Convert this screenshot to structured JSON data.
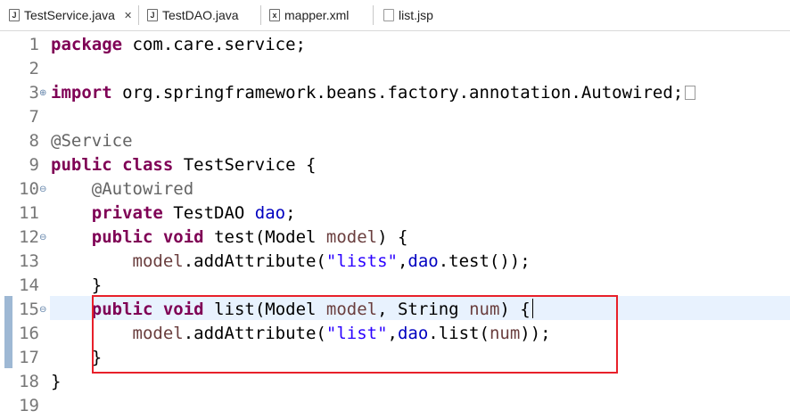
{
  "tabs": [
    {
      "label": "TestService.java",
      "icon": "java-file-icon",
      "active": true,
      "close_label": "✕"
    },
    {
      "label": "TestDAO.java",
      "icon": "java-file-icon",
      "active": false
    },
    {
      "label": "mapper.xml",
      "icon": "xml-file-icon",
      "active": false
    },
    {
      "label": "list.jsp",
      "icon": "jsp-file-icon",
      "active": false
    }
  ],
  "editor": {
    "lines": [
      {
        "num": "1",
        "segments": [
          [
            "kw",
            "package"
          ],
          [
            "t",
            " com.care.service;"
          ]
        ]
      },
      {
        "num": "2",
        "segments": []
      },
      {
        "num": "3",
        "fold": "⊕",
        "segments": [
          [
            "kw",
            "import"
          ],
          [
            "t",
            " org.springframework.beans.factory.annotation.Autowired;"
          ]
        ]
      },
      {
        "num": "7",
        "segments": []
      },
      {
        "num": "8",
        "segments": [
          [
            "ann",
            "@Service"
          ]
        ]
      },
      {
        "num": "9",
        "segments": [
          [
            "kw",
            "public"
          ],
          [
            "t",
            " "
          ],
          [
            "kw",
            "class"
          ],
          [
            "t",
            " TestService {"
          ]
        ]
      },
      {
        "num": "10",
        "fold": "⊖",
        "segments": [
          [
            "t",
            "    "
          ],
          [
            "ann",
            "@Autowired"
          ]
        ]
      },
      {
        "num": "11",
        "segments": [
          [
            "t",
            "    "
          ],
          [
            "kw",
            "private"
          ],
          [
            "t",
            " TestDAO "
          ],
          [
            "fld",
            "dao"
          ],
          [
            "t",
            ";"
          ]
        ]
      },
      {
        "num": "12",
        "fold": "⊖",
        "segments": [
          [
            "t",
            "    "
          ],
          [
            "kw",
            "public"
          ],
          [
            "t",
            " "
          ],
          [
            "kw",
            "void"
          ],
          [
            "t",
            " test(Model "
          ],
          [
            "par",
            "model"
          ],
          [
            "t",
            ") {"
          ]
        ]
      },
      {
        "num": "13",
        "segments": [
          [
            "t",
            "        "
          ],
          [
            "par",
            "model"
          ],
          [
            "t",
            ".addAttribute("
          ],
          [
            "str",
            "\"lists\""
          ],
          [
            "t",
            ","
          ],
          [
            "fld",
            "dao"
          ],
          [
            "t",
            ".test());"
          ]
        ]
      },
      {
        "num": "14",
        "segments": [
          [
            "t",
            "    }"
          ]
        ]
      },
      {
        "num": "15",
        "fold": "⊖",
        "segments": [
          [
            "t",
            "    "
          ],
          [
            "kw",
            "public"
          ],
          [
            "t",
            " "
          ],
          [
            "kw",
            "void"
          ],
          [
            "t",
            " list(Model "
          ],
          [
            "par",
            "model"
          ],
          [
            "t",
            ", String "
          ],
          [
            "par",
            "num"
          ],
          [
            "t",
            ") {"
          ]
        ]
      },
      {
        "num": "16",
        "segments": [
          [
            "t",
            "        "
          ],
          [
            "par",
            "model"
          ],
          [
            "t",
            ".addAttribute("
          ],
          [
            "str",
            "\"list\""
          ],
          [
            "t",
            ","
          ],
          [
            "fld",
            "dao"
          ],
          [
            "t",
            ".list("
          ],
          [
            "par",
            "num"
          ],
          [
            "t",
            "));"
          ]
        ]
      },
      {
        "num": "17",
        "segments": [
          [
            "t",
            "    }"
          ]
        ]
      },
      {
        "num": "18",
        "segments": [
          [
            "t",
            "}"
          ]
        ]
      },
      {
        "num": "19",
        "segments": []
      }
    ]
  },
  "colors": {
    "keyword": "#7f0055",
    "annotation": "#646464",
    "string": "#2a00ff",
    "field": "#0000c0",
    "parameter": "#6a3e3e",
    "highlight_box": "#e8202a",
    "current_line": "#e8f2fe"
  }
}
